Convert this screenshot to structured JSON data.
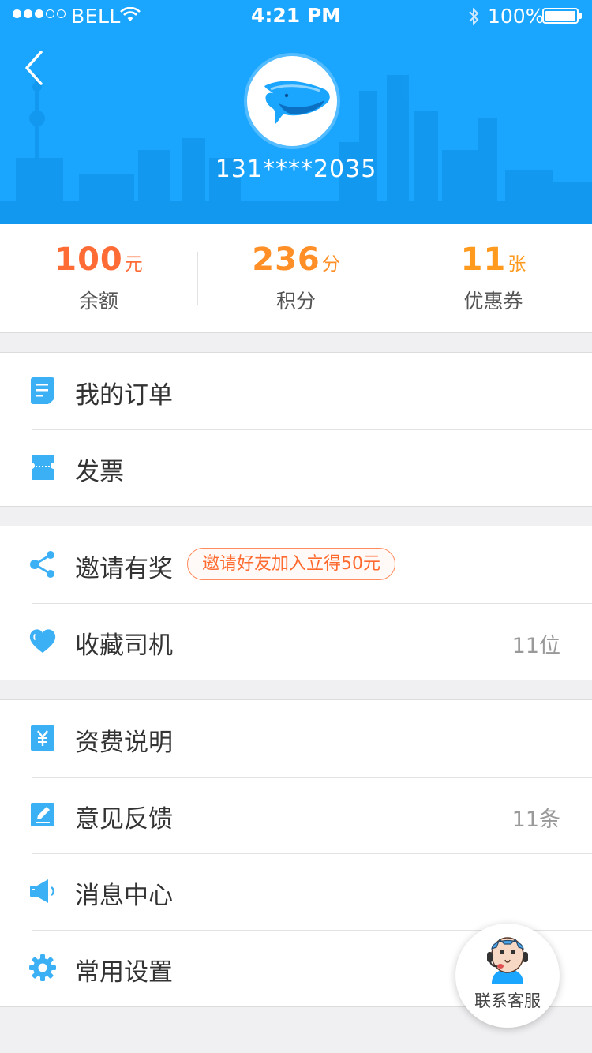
{
  "status_bar": {
    "carrier": "BELL",
    "time": "4:21 PM",
    "battery": "100%"
  },
  "header": {
    "phone": "131****2035",
    "background_color": "#1aa5ff"
  },
  "stats": [
    {
      "value": "100",
      "unit": "元",
      "label": "余额",
      "color": "#ff6b35"
    },
    {
      "value": "236",
      "unit": "分",
      "label": "积分",
      "color": "#ff8f26"
    },
    {
      "value": "11",
      "unit": "张",
      "label": "优惠券",
      "color": "#ff9a1f"
    }
  ],
  "menu": {
    "orders": {
      "label": "我的订单",
      "icon": "order-list-icon"
    },
    "invoice": {
      "label": "发票",
      "icon": "ticket-icon"
    },
    "invite": {
      "label": "邀请有奖",
      "tag": "邀请好友加入立得50元",
      "icon": "share-icon"
    },
    "fav_drivers": {
      "label": "收藏司机",
      "value": "11位",
      "icon": "heart-icon"
    },
    "pricing": {
      "label": "资费说明",
      "icon": "yuan-icon"
    },
    "feedback": {
      "label": "意见反馈",
      "value": "11条",
      "icon": "edit-icon"
    },
    "messages": {
      "label": "消息中心",
      "icon": "speaker-icon"
    },
    "settings": {
      "label": "常用设置",
      "icon": "gear-icon"
    }
  },
  "customer_service": {
    "label": "联系客服"
  },
  "colors": {
    "icon_blue": "#3cb0f5",
    "accent_orange": "#ff6a2f"
  }
}
